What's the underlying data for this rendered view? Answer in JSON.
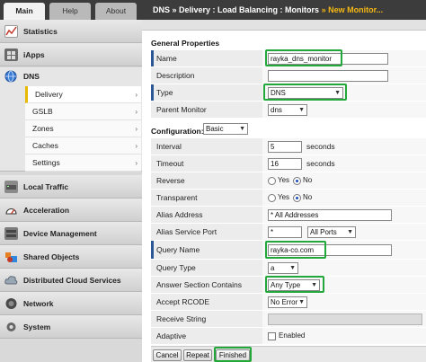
{
  "nav": {
    "tabs": [
      "Main",
      "Help",
      "About"
    ],
    "groups": {
      "statistics": "Statistics",
      "iapps": "iApps",
      "dns": "DNS",
      "local_traffic": "Local Traffic",
      "acceleration": "Acceleration",
      "device_management": "Device Management",
      "shared_objects": "Shared Objects",
      "distributed_cloud": "Distributed Cloud Services",
      "network": "Network",
      "system": "System"
    },
    "dns_items": [
      "Delivery",
      "GSLB",
      "Zones",
      "Caches",
      "Settings"
    ],
    "arrow": "›"
  },
  "breadcrumb": {
    "path": "DNS » Delivery : Load Balancing : Monitors",
    "sep": "»",
    "current": "New Monitor..."
  },
  "general": {
    "title": "General Properties",
    "name_label": "Name",
    "name_value": "rayka_dns_monitor",
    "description_label": "Description",
    "type_label": "Type",
    "type_value": "DNS",
    "parent_label": "Parent Monitor",
    "parent_value": "dns"
  },
  "config": {
    "title": "Configuration:",
    "mode": "Basic",
    "interval_label": "Interval",
    "interval_value": "5",
    "interval_unit": "seconds",
    "timeout_label": "Timeout",
    "timeout_value": "16",
    "timeout_unit": "seconds",
    "reverse_label": "Reverse",
    "transparent_label": "Transparent",
    "yes": "Yes",
    "no": "No",
    "alias_address_label": "Alias Address",
    "alias_address_value": "* All Addresses",
    "alias_port_label": "Alias Service Port",
    "alias_port_value": "*",
    "alias_port_select": "All Ports",
    "query_name_label": "Query Name",
    "query_name_value": "rayka-co.com",
    "query_type_label": "Query Type",
    "query_type_value": "a",
    "answer_label": "Answer Section Contains",
    "answer_value": "Any Type",
    "rcode_label": "Accept RCODE",
    "rcode_value": "No Error",
    "receive_label": "Receive String",
    "adaptive_label": "Adaptive",
    "adaptive_value": "Enabled"
  },
  "buttons": {
    "cancel": "Cancel",
    "repeat": "Repeat",
    "finished": "Finished"
  },
  "colors": {
    "highlight": "#22a83a",
    "required_bar": "#2b5797",
    "breadcrumb_accent": "#f5b814"
  }
}
